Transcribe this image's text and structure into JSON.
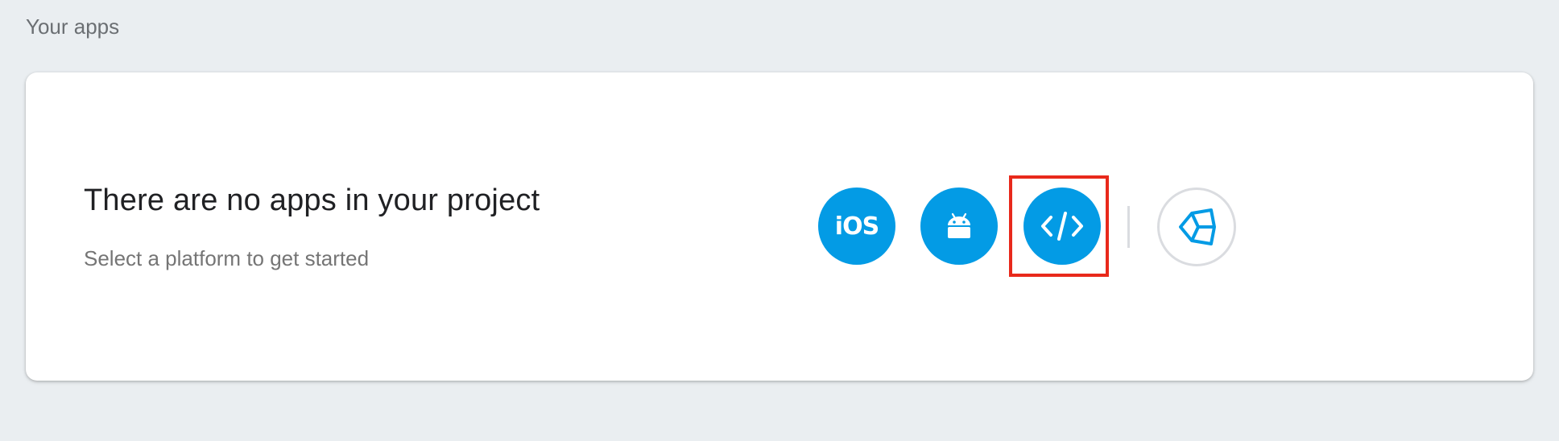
{
  "section": {
    "title": "Your apps"
  },
  "empty_state": {
    "headline": "There are no apps in your project",
    "subline": "Select a platform to get started"
  },
  "platforms": [
    {
      "name": "iOS",
      "label": "iOS",
      "icon": "ios-icon"
    },
    {
      "name": "Android",
      "icon": "android-icon"
    },
    {
      "name": "Web",
      "icon": "code-brackets-icon",
      "highlighted": true
    },
    {
      "name": "Unity",
      "icon": "unity-icon"
    }
  ],
  "colors": {
    "background": "#eaeef1",
    "accent": "#039be5",
    "highlight": "#e8291b"
  }
}
